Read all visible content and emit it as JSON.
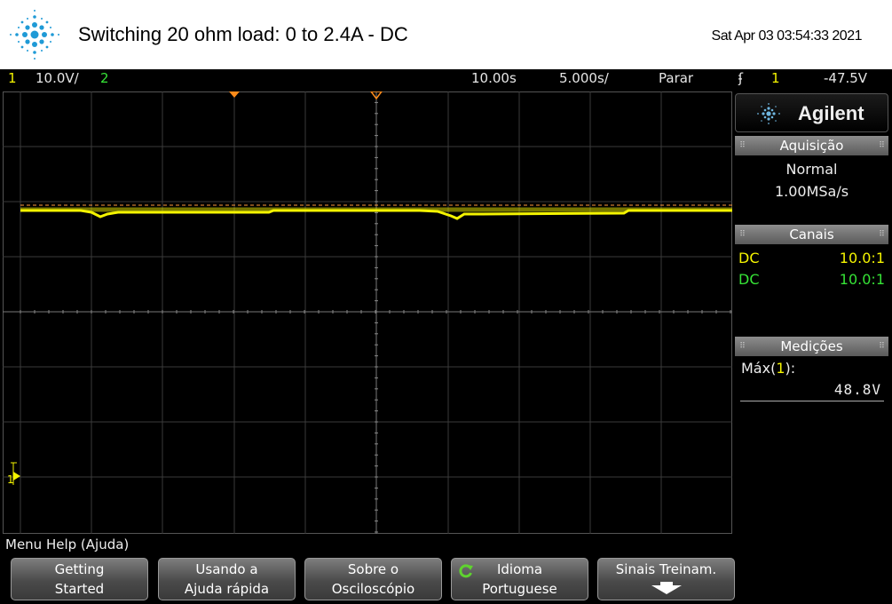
{
  "header": {
    "title": "Switching 20 ohm load: 0 to 2.4A - DC",
    "timestamp": "Sat Apr 03 03:54:33 2021",
    "logo_icon": "agilent-spark-icon"
  },
  "statusbar": {
    "ch1_number": "1",
    "ch1_scale": "10.0V/",
    "ch2_number": "2",
    "time_delay": "10.00s",
    "time_scale": "5.000s/",
    "run_state": "Parar",
    "trigger_icon": "ʄ",
    "trigger_source": "1",
    "trigger_level": "-47.5V"
  },
  "panel": {
    "brand": "Agilent",
    "acquisition": {
      "header": "Aquisição",
      "mode": "Normal",
      "rate": "1.00MSa/s"
    },
    "channels": {
      "header": "Canais",
      "rows": [
        {
          "coupling": "DC",
          "ratio": "10.0:1",
          "color": "#f4f400"
        },
        {
          "coupling": "DC",
          "ratio": "10.0:1",
          "color": "#36e336"
        }
      ]
    },
    "measurements": {
      "header": "Medições",
      "label": "Máx",
      "source": "1",
      "value": "48.8V"
    }
  },
  "graticule": {
    "ground_marker": "1"
  },
  "menu": {
    "title": "Menu Help (Ajuda)",
    "softkeys": [
      {
        "line1": "Getting",
        "line2": "Started"
      },
      {
        "line1": "Usando a",
        "line2": "Ajuda rápida"
      },
      {
        "line1": "Sobre o",
        "line2": "Osciloscópio"
      },
      {
        "line1": "Idioma",
        "line2": "Portuguese"
      },
      {
        "line1": "Sinais Treinam.",
        "line2": ""
      }
    ]
  },
  "colors": {
    "ch1": "#f4f400",
    "ch2": "#36e336",
    "trigger_marker": "#ff8c1a"
  }
}
